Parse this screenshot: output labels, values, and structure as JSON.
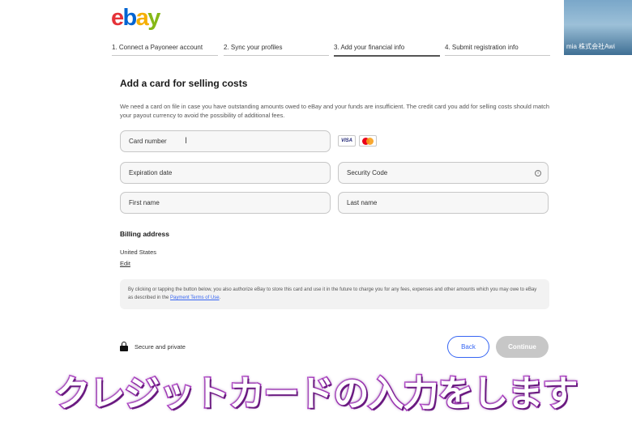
{
  "logo": {
    "letters": [
      "e",
      "b",
      "a",
      "y"
    ]
  },
  "steps": [
    {
      "label": "1. Connect a Payoneer account",
      "active": false
    },
    {
      "label": "2. Sync your profiles",
      "active": false
    },
    {
      "label": "3. Add your financial info",
      "active": true
    },
    {
      "label": "4. Submit registration info",
      "active": false
    }
  ],
  "video": {
    "participant_name": "mia 株式会社Awi"
  },
  "form": {
    "title": "Add a card for selling costs",
    "description": "We need a card on file in case you have outstanding amounts owed to eBay and your funds are insufficient. The credit card you add for selling costs should match your payout currency to avoid the possibility of additional fees.",
    "card_number_placeholder": "Card number",
    "expiration_placeholder": "Expiration date",
    "security_code_placeholder": "Security Code",
    "first_name_placeholder": "First name",
    "last_name_placeholder": "Last name",
    "card_brands": [
      "VISA",
      "mastercard"
    ]
  },
  "billing": {
    "heading": "Billing address",
    "country": "United States",
    "edit_label": "Edit"
  },
  "legal": {
    "text": "By clicking or tapping the button below, you also authorize eBay to store this card and use it in the future to charge you for any fees, expenses and other amounts which you may owe to eBay as described in the ",
    "link_label": "Payment Terms of Use",
    "suffix": "."
  },
  "footer": {
    "secure_label": "Secure and private",
    "back_label": "Back",
    "continue_label": "Continue"
  },
  "subtitle": "クレジットカードの入力をします",
  "colors": {
    "ebay_red": "#e53238",
    "ebay_blue": "#0064d2",
    "ebay_yellow": "#f5af02",
    "ebay_green": "#86b817",
    "link_blue": "#3665f3",
    "subtitle_outline": "#b23cc8"
  }
}
